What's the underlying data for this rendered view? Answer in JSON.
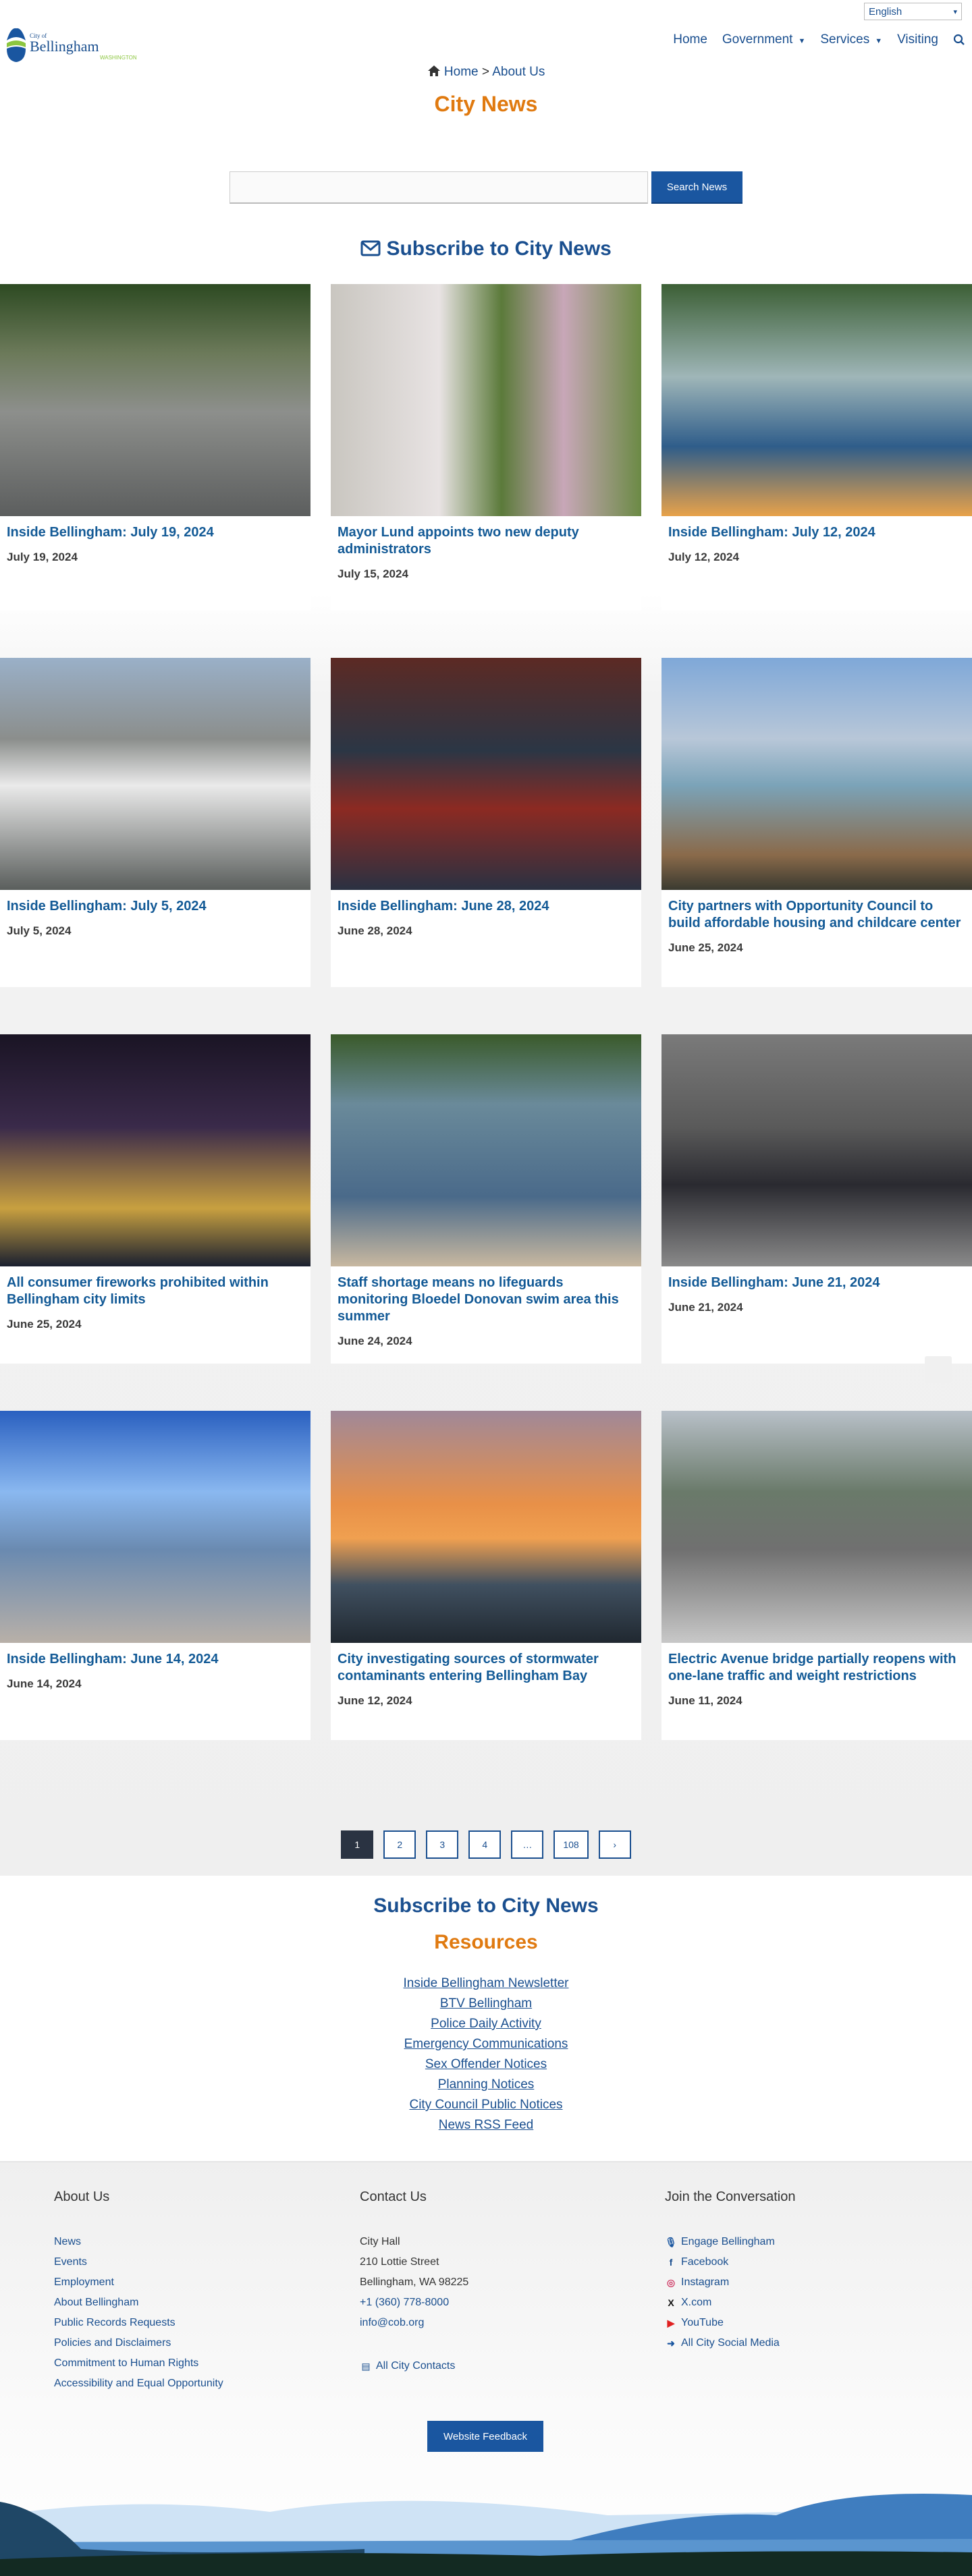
{
  "header": {
    "language": "English",
    "logo_text": "City of Bellingham Washington",
    "nav": [
      {
        "label": "Home"
      },
      {
        "label": "Government",
        "dropdown": true
      },
      {
        "label": "Services",
        "dropdown": true
      },
      {
        "label": "Visiting"
      }
    ],
    "icons": {
      "search": "search-icon",
      "home": "home-icon"
    }
  },
  "breadcrumb": {
    "home": "Home",
    "sep": ">",
    "current": "About Us"
  },
  "page_title": "City News",
  "search": {
    "placeholder": "",
    "value": "",
    "button": "Search News"
  },
  "subscribe_label": "Subscribe to City News",
  "news": [
    {
      "title": "Inside Bellingham: July 19, 2024",
      "date": "July 19, 2024"
    },
    {
      "title": "Mayor Lund appoints two new deputy administrators",
      "date": "July 15, 2024"
    },
    {
      "title": "Inside Bellingham: July 12, 2024",
      "date": "July 12, 2024"
    },
    {
      "title": "Inside Bellingham: July 5, 2024",
      "date": "July 5, 2024"
    },
    {
      "title": "Inside Bellingham: June 28, 2024",
      "date": "June 28, 2024"
    },
    {
      "title": "City partners with Opportunity Council to build affordable housing and childcare center",
      "date": "June 25, 2024"
    },
    {
      "title": "All consumer fireworks prohibited within Bellingham city limits",
      "date": "June 25, 2024"
    },
    {
      "title": "Staff shortage means no lifeguards monitoring Bloedel Donovan swim area this summer",
      "date": "June 24, 2024"
    },
    {
      "title": "Inside Bellingham: June 21, 2024",
      "date": "June 21, 2024"
    },
    {
      "title": "Inside Bellingham: June 14, 2024",
      "date": "June 14, 2024"
    },
    {
      "title": "City investigating sources of stormwater contaminants entering Bellingham Bay",
      "date": "June 12, 2024"
    },
    {
      "title": "Electric Avenue bridge partially reopens with one-lane traffic and weight restrictions",
      "date": "June 11, 2024"
    }
  ],
  "pagination": {
    "pages": [
      "1",
      "2",
      "3",
      "4",
      "…",
      "108"
    ],
    "current": "1",
    "next": "›"
  },
  "resources": {
    "title": "Resources",
    "links": [
      "Inside Bellingham Newsletter",
      "BTV Bellingham",
      "Police Daily Activity",
      "Emergency Communications",
      "Sex Offender Notices",
      "Planning Notices",
      "City Council Public Notices",
      "News RSS Feed"
    ]
  },
  "footer": {
    "about": {
      "title": "About Us",
      "links": [
        "News",
        "Events",
        "Employment",
        "About Bellingham",
        "Public Records Requests",
        "Policies and Disclaimers",
        "Commitment to Human Rights",
        "Accessibility and Equal Opportunity"
      ]
    },
    "contact": {
      "title": "Contact Us",
      "name": "City Hall",
      "street": "210 Lottie Street",
      "city": "Bellingham, WA 98225",
      "phone": "+1 (360) 778-8000",
      "email": "info@cob.org",
      "all": "All City Contacts"
    },
    "social": {
      "title": "Join the Conversation",
      "links": [
        {
          "label": "Engage Bellingham",
          "icon": "microphone-icon"
        },
        {
          "label": "Facebook",
          "icon": "facebook-icon"
        },
        {
          "label": "Instagram",
          "icon": "instagram-icon"
        },
        {
          "label": "X.com",
          "icon": "x-icon"
        },
        {
          "label": "YouTube",
          "icon": "youtube-icon"
        },
        {
          "label": "All City Social Media",
          "icon": "arrow-circle-icon"
        }
      ]
    },
    "feedback": "Website Feedback"
  },
  "colors": {
    "brand_blue": "#1a4f8f",
    "title_blue": "#135a96",
    "orange": "#e07a10",
    "button": "#1a56a0"
  }
}
